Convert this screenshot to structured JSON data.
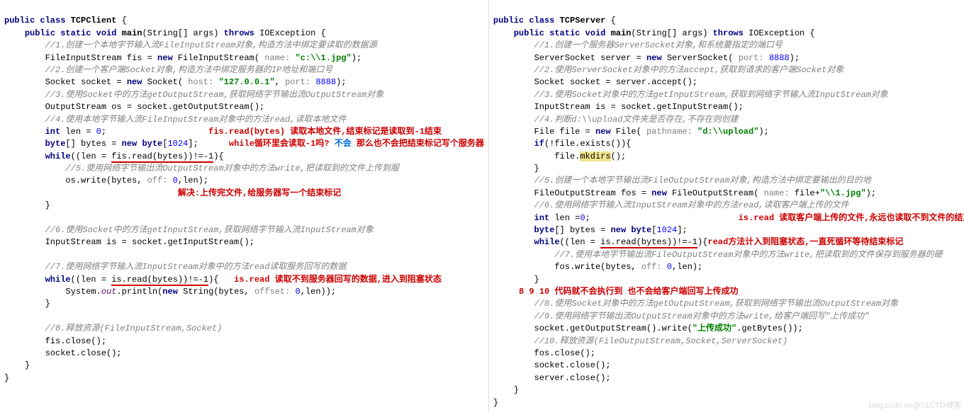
{
  "left": {
    "l1": {
      "a": "public class ",
      "b": "TCPClient",
      "c": " {"
    },
    "l2": {
      "a": "public static void ",
      "b": "main",
      "c": "(String[] args) ",
      "d": "throws ",
      "e": "IOException {"
    },
    "c1": "//1.创建一个本地字节输入流FileInputStream对象,构造方法中绑定要读取的数据源",
    "l3": {
      "a": "FileInputStream fis = ",
      "b": "new ",
      "c": "FileInputStream(",
      "p": " name: ",
      "s": "\"c:\\\\1.jpg\"",
      "e": ");"
    },
    "c2": "//2.创建一个客户端Socket对象,构造方法中绑定服务器的IP地址和端口号",
    "l4": {
      "a": "Socket socket = ",
      "b": "new ",
      "c": "Socket(",
      "p1": " host: ",
      "s": "\"127.0.0.1\"",
      "m": ", ",
      "p2": "port: ",
      "n": "8888",
      "e": ");"
    },
    "c3": "//3.使用Socket中的方法getOutputStream,获取网络字节输出流OutputStream对象",
    "l5": "OutputStream os = socket.getOutputStream();",
    "c4": "//4.使用本地字节输入流FileInputStream对象中的方法read,读取本地文件",
    "l6": {
      "a": "int ",
      "b": "len = ",
      "n": "0",
      "e": ";"
    },
    "ann1": "fis.read(bytes) 读取本地文件,结束标记是读取到-1结束",
    "l7": {
      "a": "byte",
      "b": "[] bytes = ",
      "c": "new byte",
      "d": "[",
      "n": "1024",
      "e": "];"
    },
    "ann2a": "while循环里会读取-1吗? ",
    "ann2b": "不会",
    "ann2c": " 那么也不会把结束标记写个服务器",
    "l8": {
      "a": "while",
      "b": "((len = ",
      "u": "fis.read(bytes))!=-1",
      "e": "){"
    },
    "c5": "//5.使用网络字节输出流OutputStream对象中的方法write,把读取到的文件上传到服",
    "l9": {
      "a": "os.write(bytes, ",
      "p": "off: ",
      "n": "0",
      "m": ",len);"
    },
    "ann3": "解决:上传完文件,给服务器写一个结束标记",
    "brace1": "}",
    "c6": "//6.使用Socket中的方法getInputStream,获取网络字节输入流InputStream对象",
    "l10": "InputStream is = socket.getInputStream();",
    "c7": "//7.使用网络字节输入流InputStream对象中的方法read读取服务回写的数据",
    "l11": {
      "a": "while",
      "b": "((len = ",
      "u": "is.read(bytes))!=-1",
      "e": "){"
    },
    "ann4": "is.read 读取不到服务器回写的数据,进入到阻塞状态",
    "l12": {
      "a": "System.",
      "f": "out",
      "b": ".println(",
      "c": "new ",
      "d": "String(bytes, ",
      "p": "offset: ",
      "n": "0",
      "e": ",len));"
    },
    "brace2": "}",
    "c8": "//8.释放资源(FileInputStream,Socket)",
    "l13": "fis.close();",
    "l14": "socket.close();",
    "brace3": "}",
    "brace4": "}"
  },
  "right": {
    "l1": {
      "a": "public class ",
      "b": "TCPServer",
      "c": " {"
    },
    "l2": {
      "a": "public static void ",
      "b": "main",
      "c": "(String[] args) ",
      "d": "throws ",
      "e": "IOException {"
    },
    "c1": "//1.创建一个服务器ServerSocket对象,和系统要指定的端口号",
    "l3": {
      "a": "ServerSocket server = ",
      "b": "new ",
      "c": "ServerSocket(",
      "p": " port: ",
      "n": "8888",
      "e": ");"
    },
    "c2": "//2.使用ServerSocket对象中的方法accept,获取到请求的客户端Socket对象",
    "l4": "Socket socket = server.accept();",
    "c3": "//3.使用Socket对象中的方法getInputStream,获取到网络字节输入流InputStream对象",
    "l5": "InputStream is = socket.getInputStream();",
    "c4": "//4.判断d:\\\\upload文件夹是否存在,不存在则创建",
    "l6": {
      "a": "File file = ",
      "b": "new ",
      "c": "File(",
      "p": " pathname: ",
      "s": "\"d:\\\\upload\"",
      "e": ");"
    },
    "l7": {
      "a": "if",
      "b": "(!file.exists()){"
    },
    "l8": {
      "a": "file.",
      "m": "mkdirs",
      "e": "();"
    },
    "brace1": "}",
    "c5": "//5.创建一个本地字节输出流FileOutputStream对象,构造方法中绑定要输出的目的地",
    "l9": {
      "a": "FileOutputStream fos = ",
      "b": "new ",
      "c": "FileOutputStream(",
      "p": " name: ",
      "d": "file+",
      "s": "\"\\\\1.jpg\"",
      "e": ");"
    },
    "c6": "//6.使用网络字节输入流InputStream对象中的方法read,读取客户端上传的文件",
    "l10": {
      "a": "int ",
      "b": "len =",
      "n": "0",
      "e": ";"
    },
    "ann1": "is.read 读取客户端上传的文件,永远也读取不到文件的结束标记",
    "l11": {
      "a": "byte",
      "b": "[] bytes = ",
      "c": "new byte",
      "d": "[",
      "n": "1024",
      "e": "];"
    },
    "l12": {
      "a": "while",
      "b": "((len = ",
      "u": "is.read(bytes))!=-1",
      "e": "){"
    },
    "ann2": "read方法计入到阻塞状态,一直死循环等待结束标记",
    "c7": "//7.使用本地字节输出流FileOutputStream对象中的方法write,把读取到的文件保存到服务器的硬",
    "l13": {
      "a": "fos.write(bytes, ",
      "p": "off: ",
      "n": "0",
      "m": ",len);"
    },
    "brace2": "}",
    "ann3": "8 9 10 代码就不会执行到 也不会给客户端回写上传成功",
    "c8": "//8.使用Socket对象中的方法getOutputStream,获取到网络字节输出流OutputStream对象",
    "c9": "//9.使用网络字节输出流OutputStream对象中的方法write,给客户端回写\"上传成功\"",
    "l14": {
      "a": "socket.getOutputStream().write(",
      "s": "\"上传成功\"",
      "b": ".getBytes());"
    },
    "c10": "//10.释放资源(FileOutputStream,Socket,ServerSocket)",
    "l15": "fos.close();",
    "l16": "socket.close();",
    "l17": "server.close();",
    "brace3": "}",
    "brace4": "}"
  },
  "watermark": "blog.csdn.ne@51CTO博客"
}
